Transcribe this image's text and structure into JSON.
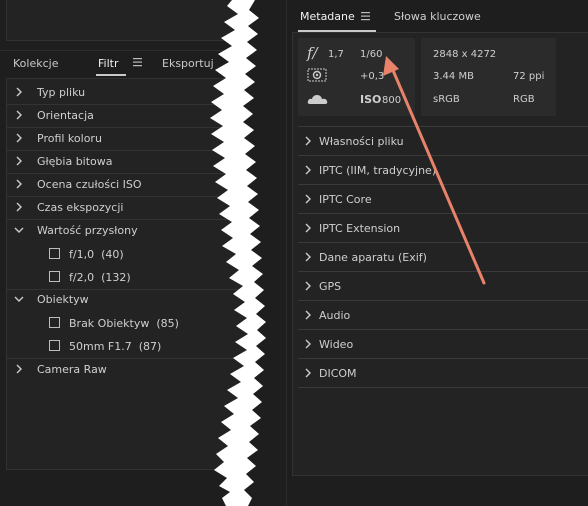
{
  "left_panel": {
    "tabs": [
      "Kolekcje",
      "Filtr",
      "Eksportuj"
    ],
    "active_tab": "Filtr",
    "filters": [
      {
        "label": "Typ pliku",
        "expanded": false
      },
      {
        "label": "Orientacja",
        "expanded": false
      },
      {
        "label": "Profil koloru",
        "expanded": false
      },
      {
        "label": "Głębia bitowa",
        "expanded": false
      },
      {
        "label": "Ocena czułości ISO",
        "expanded": false
      },
      {
        "label": "Czas ekspozycji",
        "expanded": false
      },
      {
        "label": "Wartość przysłony",
        "expanded": true
      },
      {
        "label": "Obiektyw",
        "expanded": true
      },
      {
        "label": "Camera Raw",
        "expanded": false
      }
    ],
    "aperture_options": [
      {
        "label": "f/1,0",
        "count": "(40)"
      },
      {
        "label": "f/2,0",
        "count": "(132)"
      }
    ],
    "lens_options": [
      {
        "label": "Brak Obiektyw",
        "count": "(85)"
      },
      {
        "label": "50mm F1.7",
        "count": "(87)"
      }
    ]
  },
  "right_panel": {
    "tabs": [
      "Metadane",
      "Słowa kluczowe"
    ],
    "active_tab": "Metadane",
    "exposure": {
      "aperture_icon": "f/",
      "aperture": "1,7",
      "shutter": "1/60",
      "exposure_comp": "+0,3",
      "iso_label": "ISO",
      "iso": "800"
    },
    "file_info": {
      "dimensions": "2848 x 4272",
      "size": "3.44 MB",
      "ppi": "72 ppi",
      "color_space": "sRGB",
      "mode": "RGB"
    },
    "sections": [
      "Własności pliku",
      "IPTC (IIM, tradycyjne)",
      "IPTC Core",
      "IPTC Extension",
      "Dane aparatu (Exif)",
      "GPS",
      "Audio",
      "Wideo",
      "DICOM"
    ]
  },
  "colors": {
    "background": "#1e1e1e",
    "panel": "#232323",
    "arrow": "#e8826a"
  }
}
